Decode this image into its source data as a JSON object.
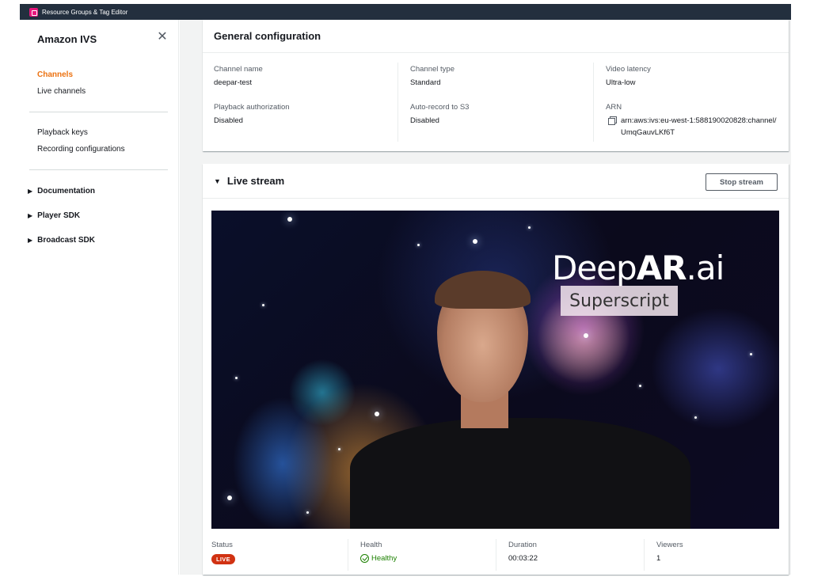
{
  "topbar": {
    "label": "Resource Groups & Tag Editor"
  },
  "sidebar": {
    "title": "Amazon IVS",
    "links_group1": [
      {
        "label": "Channels",
        "active": true
      },
      {
        "label": "Live channels",
        "active": false
      }
    ],
    "links_group2": [
      {
        "label": "Playback keys"
      },
      {
        "label": "Recording configurations"
      }
    ],
    "sections": [
      {
        "label": "Documentation"
      },
      {
        "label": "Player SDK"
      },
      {
        "label": "Broadcast SDK"
      }
    ]
  },
  "general": {
    "title": "General configuration",
    "channel_name_label": "Channel name",
    "channel_name_value": "deepar-test",
    "channel_type_label": "Channel type",
    "channel_type_value": "Standard",
    "video_latency_label": "Video latency",
    "video_latency_value": "Ultra-low",
    "playback_auth_label": "Playback authorization",
    "playback_auth_value": "Disabled",
    "auto_record_label": "Auto-record to S3",
    "auto_record_value": "Disabled",
    "arn_label": "ARN",
    "arn_value": "arn:aws:ivs:eu-west-1:588190020828:channel/UmqGauvLKf6T"
  },
  "live": {
    "title": "Live stream",
    "stop_button": "Stop stream",
    "video": {
      "brand_light": "Deep",
      "brand_bold": "AR",
      "brand_suffix": ".ai",
      "overlay_label": "Superscript"
    },
    "status_label": "Status",
    "status_value": "LIVE",
    "health_label": "Health",
    "health_value": "Healthy",
    "duration_label": "Duration",
    "duration_value": "00:03:22",
    "viewers_label": "Viewers",
    "viewers_value": "1"
  },
  "colors": {
    "active_link": "#ec7211",
    "live_badge": "#d13212",
    "healthy": "#1d8102",
    "topbar": "#232f3e"
  }
}
